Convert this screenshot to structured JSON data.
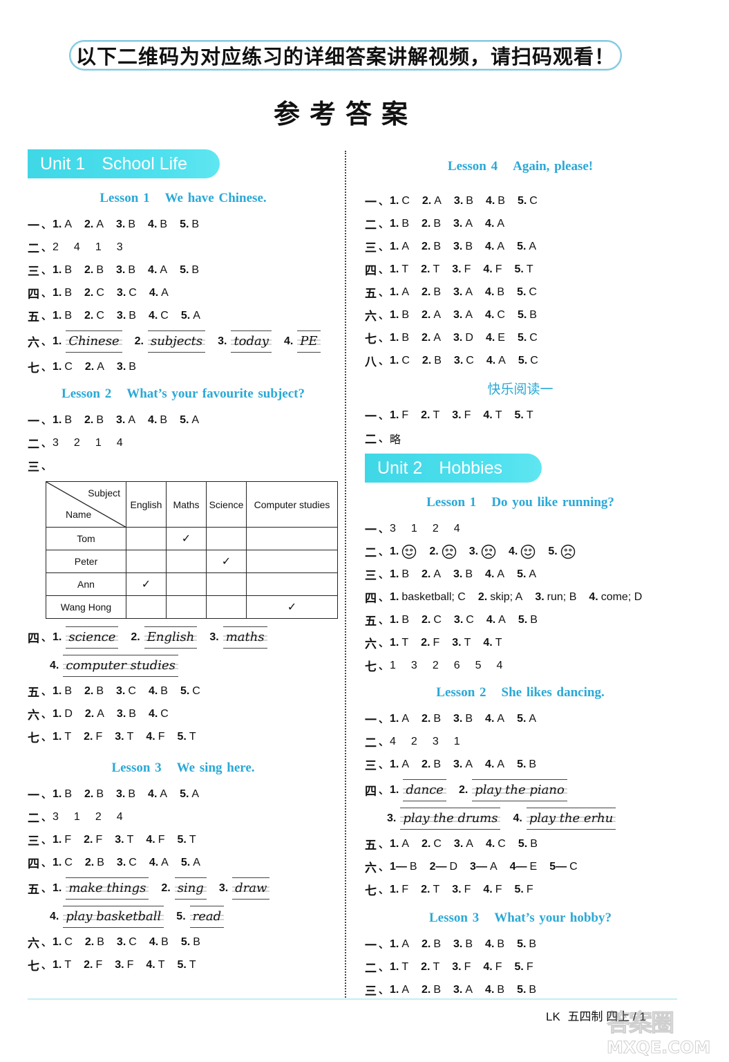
{
  "banner_text": "以下二维码为对应练习的详细答案讲解视频，请扫码观看！",
  "page_title": "参考答案",
  "units": [
    {
      "num": "Unit 1",
      "name": "School Life"
    },
    {
      "num": "Unit 2",
      "name": "Hobbies"
    }
  ],
  "left": {
    "u1l1": {
      "lesson": "Lesson 1",
      "title": "We have Chinese.",
      "rows": {
        "r1": {
          "sec": "一",
          "items": [
            [
              "1.",
              "A"
            ],
            [
              "2.",
              "A"
            ],
            [
              "3.",
              "B"
            ],
            [
              "4.",
              "B"
            ],
            [
              "5.",
              "B"
            ]
          ]
        },
        "r2": {
          "sec": "二",
          "seq": [
            "2",
            "4",
            "1",
            "3"
          ]
        },
        "r3": {
          "sec": "三",
          "items": [
            [
              "1.",
              "B"
            ],
            [
              "2.",
              "B"
            ],
            [
              "3.",
              "B"
            ],
            [
              "4.",
              "A"
            ],
            [
              "5.",
              "B"
            ]
          ]
        },
        "r4": {
          "sec": "四",
          "items": [
            [
              "1.",
              "B"
            ],
            [
              "2.",
              "C"
            ],
            [
              "3.",
              "C"
            ],
            [
              "4.",
              "A"
            ]
          ]
        },
        "r5": {
          "sec": "五",
          "items": [
            [
              "1.",
              "B"
            ],
            [
              "2.",
              "C"
            ],
            [
              "3.",
              "B"
            ],
            [
              "4.",
              "C"
            ],
            [
              "5.",
              "A"
            ]
          ]
        },
        "r6": {
          "sec": "六",
          "words": [
            [
              "1.",
              "Chinese"
            ],
            [
              "2.",
              "subjects"
            ],
            [
              "3.",
              "today"
            ],
            [
              "4.",
              "PE"
            ]
          ]
        },
        "r7": {
          "sec": "七",
          "items": [
            [
              "1.",
              "C"
            ],
            [
              "2.",
              "A"
            ],
            [
              "3.",
              "B"
            ]
          ]
        }
      }
    },
    "u1l2": {
      "lesson": "Lesson 2",
      "title": "What’s your favourite subject?",
      "rows": {
        "r1": {
          "sec": "一",
          "items": [
            [
              "1.",
              "B"
            ],
            [
              "2.",
              "B"
            ],
            [
              "3.",
              "A"
            ],
            [
              "4.",
              "B"
            ],
            [
              "5.",
              "A"
            ]
          ]
        },
        "r2": {
          "sec": "二",
          "seq": [
            "3",
            "2",
            "1",
            "4"
          ]
        },
        "r3": {
          "sec": "三"
        },
        "table": {
          "corner_subject": "Subject",
          "corner_name": "Name",
          "columns": [
            "English",
            "Maths",
            "Science",
            "Computer studies"
          ],
          "rows": [
            {
              "name": "Tom",
              "checked": "Maths"
            },
            {
              "name": "Peter",
              "checked": "Science"
            },
            {
              "name": "Ann",
              "checked": "English"
            },
            {
              "name": "Wang Hong",
              "checked": "Computer studies"
            }
          ],
          "check_mark": "✓"
        },
        "r4": {
          "sec": "四",
          "words": [
            [
              "1.",
              "science"
            ],
            [
              "2.",
              "English"
            ],
            [
              "3.",
              "maths"
            ],
            [
              "4.",
              "computer studies"
            ]
          ]
        },
        "r5": {
          "sec": "五",
          "items": [
            [
              "1.",
              "B"
            ],
            [
              "2.",
              "B"
            ],
            [
              "3.",
              "C"
            ],
            [
              "4.",
              "B"
            ],
            [
              "5.",
              "C"
            ]
          ]
        },
        "r6": {
          "sec": "六",
          "items": [
            [
              "1.",
              "D"
            ],
            [
              "2.",
              "A"
            ],
            [
              "3.",
              "B"
            ],
            [
              "4.",
              "C"
            ]
          ]
        },
        "r7": {
          "sec": "七",
          "items": [
            [
              "1.",
              "T"
            ],
            [
              "2.",
              "F"
            ],
            [
              "3.",
              "T"
            ],
            [
              "4.",
              "F"
            ],
            [
              "5.",
              "T"
            ]
          ]
        }
      }
    },
    "u1l3": {
      "lesson": "Lesson 3",
      "title": "We sing here.",
      "rows": {
        "r1": {
          "sec": "一",
          "items": [
            [
              "1.",
              "B"
            ],
            [
              "2.",
              "B"
            ],
            [
              "3.",
              "B"
            ],
            [
              "4.",
              "A"
            ],
            [
              "5.",
              "A"
            ]
          ]
        },
        "r2": {
          "sec": "二",
          "seq": [
            "3",
            "1",
            "2",
            "4"
          ]
        },
        "r3": {
          "sec": "三",
          "items": [
            [
              "1.",
              "F"
            ],
            [
              "2.",
              "F"
            ],
            [
              "3.",
              "T"
            ],
            [
              "4.",
              "F"
            ],
            [
              "5.",
              "T"
            ]
          ]
        },
        "r4": {
          "sec": "四",
          "items": [
            [
              "1.",
              "C"
            ],
            [
              "2.",
              "B"
            ],
            [
              "3.",
              "C"
            ],
            [
              "4.",
              "A"
            ],
            [
              "5.",
              "A"
            ]
          ]
        },
        "r5": {
          "sec": "五",
          "words": [
            [
              "1.",
              "make things"
            ],
            [
              "2.",
              "sing"
            ],
            [
              "3.",
              "draw"
            ],
            [
              "4.",
              "play basketball"
            ],
            [
              "5.",
              "read"
            ]
          ]
        },
        "r6": {
          "sec": "六",
          "items": [
            [
              "1.",
              "C"
            ],
            [
              "2.",
              "B"
            ],
            [
              "3.",
              "C"
            ],
            [
              "4.",
              "B"
            ],
            [
              "5.",
              "B"
            ]
          ]
        },
        "r7": {
          "sec": "七",
          "items": [
            [
              "1.",
              "T"
            ],
            [
              "2.",
              "F"
            ],
            [
              "3.",
              "F"
            ],
            [
              "4.",
              "T"
            ],
            [
              "5.",
              "T"
            ]
          ]
        }
      }
    }
  },
  "right": {
    "u1l4": {
      "lesson": "Lesson 4",
      "title": "Again, please!",
      "rows": {
        "r1": {
          "sec": "一",
          "items": [
            [
              "1.",
              "C"
            ],
            [
              "2.",
              "A"
            ],
            [
              "3.",
              "B"
            ],
            [
              "4.",
              "B"
            ],
            [
              "5.",
              "C"
            ]
          ]
        },
        "r2": {
          "sec": "二",
          "items": [
            [
              "1.",
              "B"
            ],
            [
              "2.",
              "B"
            ],
            [
              "3.",
              "A"
            ],
            [
              "4.",
              "A"
            ]
          ]
        },
        "r3": {
          "sec": "三",
          "items": [
            [
              "1.",
              "A"
            ],
            [
              "2.",
              "B"
            ],
            [
              "3.",
              "B"
            ],
            [
              "4.",
              "A"
            ],
            [
              "5.",
              "A"
            ]
          ]
        },
        "r4": {
          "sec": "四",
          "items": [
            [
              "1.",
              "T"
            ],
            [
              "2.",
              "T"
            ],
            [
              "3.",
              "F"
            ],
            [
              "4.",
              "F"
            ],
            [
              "5.",
              "T"
            ]
          ]
        },
        "r5": {
          "sec": "五",
          "items": [
            [
              "1.",
              "A"
            ],
            [
              "2.",
              "B"
            ],
            [
              "3.",
              "A"
            ],
            [
              "4.",
              "B"
            ],
            [
              "5.",
              "C"
            ]
          ]
        },
        "r6": {
          "sec": "六",
          "items": [
            [
              "1.",
              "B"
            ],
            [
              "2.",
              "A"
            ],
            [
              "3.",
              "A"
            ],
            [
              "4.",
              "C"
            ],
            [
              "5.",
              "B"
            ]
          ]
        },
        "r7": {
          "sec": "七",
          "items": [
            [
              "1.",
              "B"
            ],
            [
              "2.",
              "A"
            ],
            [
              "3.",
              "D"
            ],
            [
              "4.",
              "E"
            ],
            [
              "5.",
              "C"
            ]
          ]
        },
        "r8": {
          "sec": "八",
          "items": [
            [
              "1.",
              "C"
            ],
            [
              "2.",
              "B"
            ],
            [
              "3.",
              "C"
            ],
            [
              "4.",
              "A"
            ],
            [
              "5.",
              "C"
            ]
          ]
        }
      }
    },
    "reading": {
      "title": "快乐阅读一",
      "rows": {
        "r1": {
          "sec": "一",
          "items": [
            [
              "1.",
              "F"
            ],
            [
              "2.",
              "T"
            ],
            [
              "3.",
              "F"
            ],
            [
              "4.",
              "T"
            ],
            [
              "5.",
              "T"
            ]
          ]
        },
        "r2": {
          "sec": "二",
          "text": "略"
        }
      }
    },
    "u2l1": {
      "lesson": "Lesson 1",
      "title": "Do you like running?",
      "rows": {
        "r1": {
          "sec": "一",
          "seq": [
            "3",
            "1",
            "2",
            "4"
          ]
        },
        "r2": {
          "sec": "二",
          "faces": [
            [
              "1.",
              "smile"
            ],
            [
              "2.",
              "frown"
            ],
            [
              "3.",
              "frown"
            ],
            [
              "4.",
              "smile"
            ],
            [
              "5.",
              "frown"
            ]
          ]
        },
        "r3": {
          "sec": "三",
          "items": [
            [
              "1.",
              "B"
            ],
            [
              "2.",
              "A"
            ],
            [
              "3.",
              "B"
            ],
            [
              "4.",
              "A"
            ],
            [
              "5.",
              "A"
            ]
          ]
        },
        "r4": {
          "sec": "四",
          "items": [
            [
              "1.",
              "basketball; C"
            ],
            [
              "2.",
              "skip; A"
            ],
            [
              "3.",
              "run; B"
            ],
            [
              "4.",
              "come; D"
            ]
          ]
        },
        "r5": {
          "sec": "五",
          "items": [
            [
              "1.",
              "B"
            ],
            [
              "2.",
              "C"
            ],
            [
              "3.",
              "C"
            ],
            [
              "4.",
              "A"
            ],
            [
              "5.",
              "B"
            ]
          ]
        },
        "r6": {
          "sec": "六",
          "items": [
            [
              "1.",
              "T"
            ],
            [
              "2.",
              "F"
            ],
            [
              "3.",
              "T"
            ],
            [
              "4.",
              "T"
            ]
          ]
        },
        "r7": {
          "sec": "七",
          "seq": [
            "1",
            "3",
            "2",
            "6",
            "5",
            "4"
          ]
        }
      }
    },
    "u2l2": {
      "lesson": "Lesson 2",
      "title": "She likes dancing.",
      "rows": {
        "r1": {
          "sec": "一",
          "items": [
            [
              "1.",
              "A"
            ],
            [
              "2.",
              "B"
            ],
            [
              "3.",
              "B"
            ],
            [
              "4.",
              "A"
            ],
            [
              "5.",
              "A"
            ]
          ]
        },
        "r2": {
          "sec": "二",
          "seq": [
            "4",
            "2",
            "3",
            "1"
          ]
        },
        "r3": {
          "sec": "三",
          "items": [
            [
              "1.",
              "A"
            ],
            [
              "2.",
              "B"
            ],
            [
              "3.",
              "A"
            ],
            [
              "4.",
              "A"
            ],
            [
              "5.",
              "B"
            ]
          ]
        },
        "r4": {
          "sec": "四",
          "words": [
            [
              "1.",
              "dance"
            ],
            [
              "2.",
              "play the piano"
            ],
            [
              "3.",
              "play the drums"
            ],
            [
              "4.",
              "play the erhu"
            ]
          ]
        },
        "r5": {
          "sec": "五",
          "items": [
            [
              "1.",
              "A"
            ],
            [
              "2.",
              "C"
            ],
            [
              "3.",
              "A"
            ],
            [
              "4.",
              "C"
            ],
            [
              "5.",
              "B"
            ]
          ]
        },
        "r6": {
          "sec": "六",
          "items": [
            [
              "1—",
              "B"
            ],
            [
              "2—",
              "D"
            ],
            [
              "3—",
              "A"
            ],
            [
              "4—",
              "E"
            ],
            [
              "5—",
              "C"
            ]
          ]
        },
        "r7": {
          "sec": "七",
          "items": [
            [
              "1.",
              "F"
            ],
            [
              "2.",
              "T"
            ],
            [
              "3.",
              "F"
            ],
            [
              "4.",
              "F"
            ],
            [
              "5.",
              "F"
            ]
          ]
        }
      }
    },
    "u2l3": {
      "lesson": "Lesson 3",
      "title": "What’s your hobby?",
      "rows": {
        "r1": {
          "sec": "一",
          "items": [
            [
              "1.",
              "A"
            ],
            [
              "2.",
              "B"
            ],
            [
              "3.",
              "B"
            ],
            [
              "4.",
              "B"
            ],
            [
              "5.",
              "B"
            ]
          ]
        },
        "r2": {
          "sec": "二",
          "items": [
            [
              "1.",
              "T"
            ],
            [
              "2.",
              "T"
            ],
            [
              "3.",
              "F"
            ],
            [
              "4.",
              "F"
            ],
            [
              "5.",
              "F"
            ]
          ]
        },
        "r3": {
          "sec": "三",
          "items": [
            [
              "1.",
              "A"
            ],
            [
              "2.",
              "B"
            ],
            [
              "3.",
              "A"
            ],
            [
              "4.",
              "B"
            ],
            [
              "5.",
              "B"
            ]
          ]
        }
      }
    }
  },
  "footer": {
    "code": "LK",
    "system": "五四制",
    "grade": "四上",
    "sep": "/",
    "page": "1"
  },
  "watermark": {
    "line1": "答案圈",
    "line2": "MXQE.COM"
  },
  "colors": {
    "accent_blue": "#2aa8d6",
    "unit_banner": "#4ee0ee",
    "banner_border": "#7cc7df"
  }
}
